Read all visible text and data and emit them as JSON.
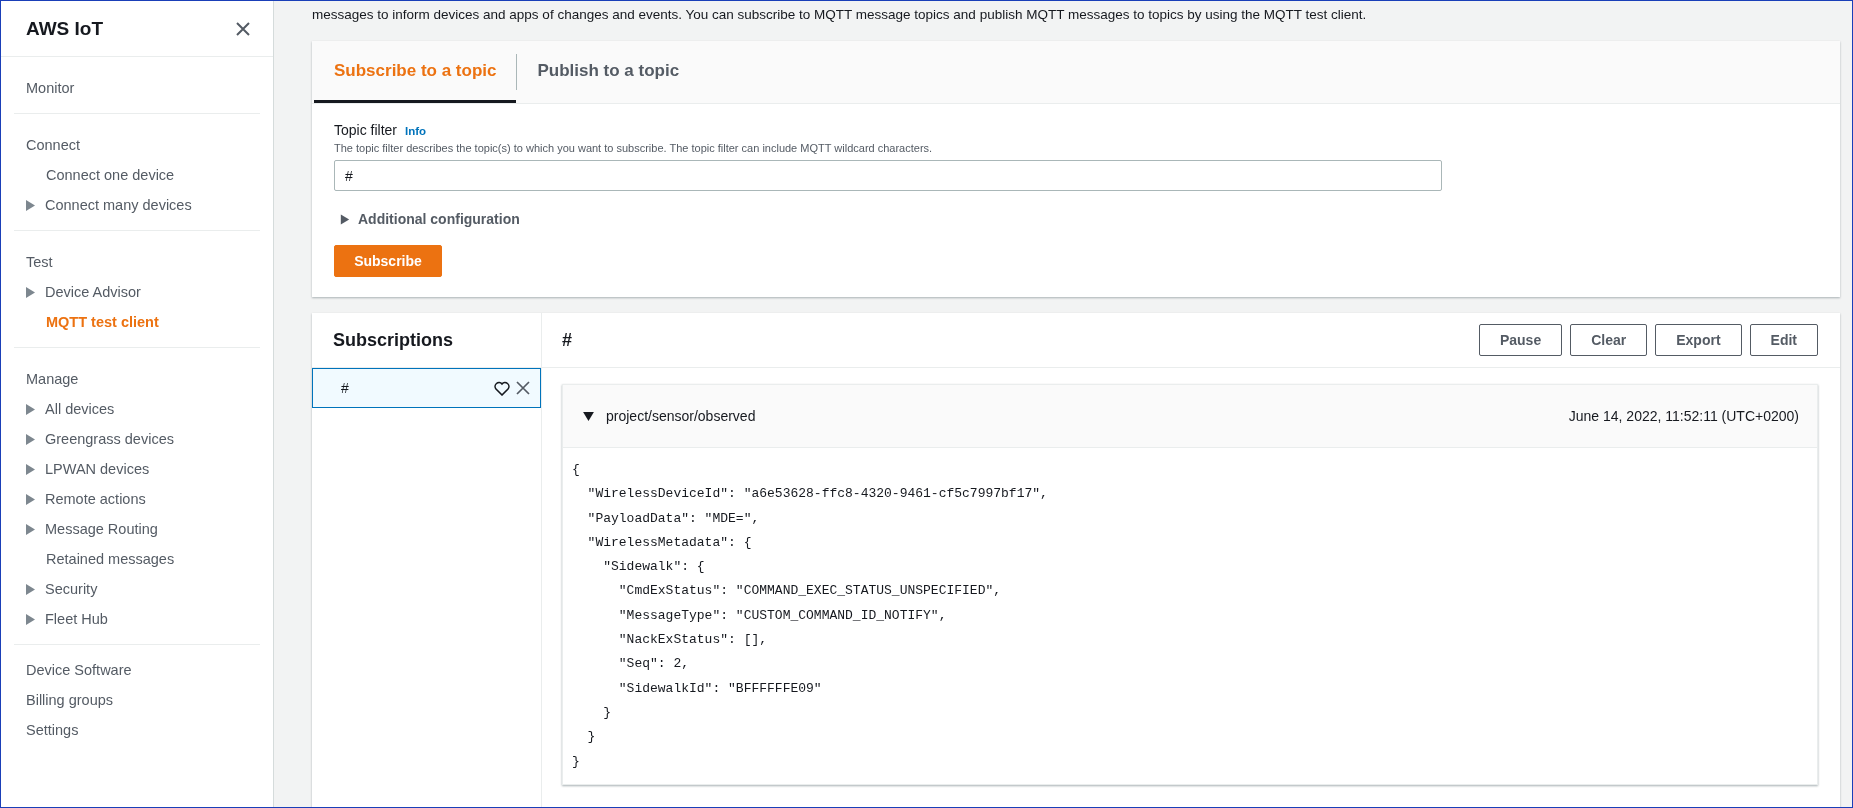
{
  "sidebar": {
    "title": "AWS IoT",
    "groups": [
      [
        {
          "label": "Monitor",
          "kind": "header",
          "selected": false
        }
      ],
      [
        {
          "label": "Connect",
          "kind": "header",
          "selected": false
        },
        {
          "label": "Connect one device",
          "kind": "link",
          "selected": false
        },
        {
          "label": "Connect many devices",
          "kind": "expandable",
          "selected": false
        }
      ],
      [
        {
          "label": "Test",
          "kind": "header",
          "selected": false
        },
        {
          "label": "Device Advisor",
          "kind": "expandable",
          "selected": false
        },
        {
          "label": "MQTT test client",
          "kind": "link",
          "selected": true
        }
      ],
      [
        {
          "label": "Manage",
          "kind": "header",
          "selected": false
        },
        {
          "label": "All devices",
          "kind": "expandable",
          "selected": false
        },
        {
          "label": "Greengrass devices",
          "kind": "expandable",
          "selected": false
        },
        {
          "label": "LPWAN devices",
          "kind": "expandable",
          "selected": false
        },
        {
          "label": "Remote actions",
          "kind": "expandable",
          "selected": false
        },
        {
          "label": "Message Routing",
          "kind": "expandable",
          "selected": false
        },
        {
          "label": "Retained messages",
          "kind": "link",
          "selected": false
        },
        {
          "label": "Security",
          "kind": "expandable",
          "selected": false
        },
        {
          "label": "Fleet Hub",
          "kind": "expandable",
          "selected": false
        }
      ],
      [
        {
          "label": "Device Software",
          "kind": "header",
          "selected": false
        },
        {
          "label": "Billing groups",
          "kind": "header",
          "selected": false
        },
        {
          "label": "Settings",
          "kind": "header",
          "selected": false
        }
      ]
    ]
  },
  "intro": "messages to inform devices and apps of changes and events. You can subscribe to MQTT message topics and publish MQTT messages to topics by using the MQTT test client.",
  "tabs": [
    {
      "label": "Subscribe to a topic",
      "selected": true
    },
    {
      "label": "Publish to a topic",
      "selected": false
    }
  ],
  "topic_filter": {
    "label": "Topic filter",
    "info": "Info",
    "description": "The topic filter describes the topic(s) to which you want to subscribe. The topic filter can include MQTT wildcard characters.",
    "value": "#"
  },
  "additional_configuration": {
    "label": "Additional configuration",
    "expanded": false
  },
  "subscribe_button": "Subscribe",
  "subscriptions": {
    "title": "Subscriptions",
    "items": [
      {
        "topic": "#",
        "selected": true
      }
    ]
  },
  "messages_panel": {
    "title": "#",
    "buttons": [
      "Pause",
      "Clear",
      "Export",
      "Edit"
    ],
    "messages": [
      {
        "topic": "project/sensor/observed",
        "timestamp": "June 14, 2022, 11:52:11 (UTC+0200)",
        "expanded": true,
        "lines": [
          "{",
          "  \"WirelessDeviceId\": \"a6e53628-ffc8-4320-9461-cf5c7997bf17\",",
          "  \"PayloadData\": \"MDE=\",",
          "  \"WirelessMetadata\": {",
          "    \"Sidewalk\": {",
          "      \"CmdExStatus\": \"COMMAND_EXEC_STATUS_UNSPECIFIED\",",
          "      \"MessageType\": \"CUSTOM_COMMAND_ID_NOTIFY\",",
          "      \"NackExStatus\": [],",
          "      \"Seq\": 2,",
          "      \"SidewalkId\": \"BFFFFFFE09\"",
          "    }",
          "  }",
          "}"
        ]
      }
    ]
  }
}
